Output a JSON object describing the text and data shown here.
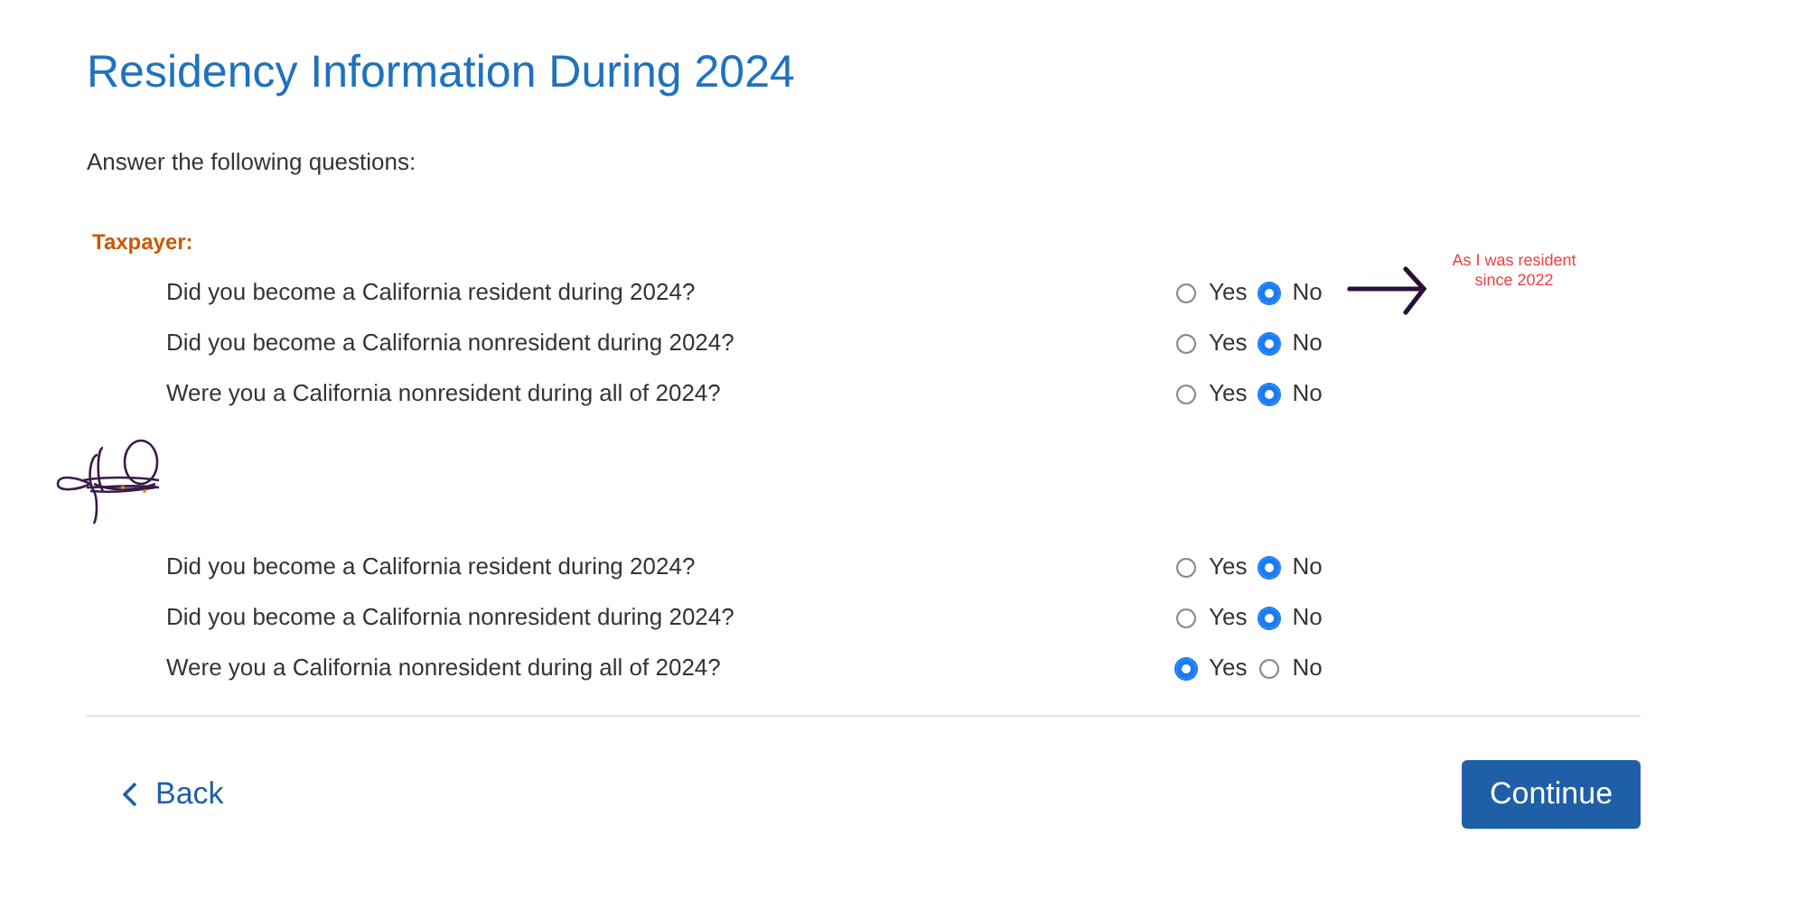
{
  "title": "Residency Information During 2024",
  "intro": "Answer the following questions:",
  "groups": [
    {
      "kind": "labeled",
      "label": "Taxpayer:",
      "questions": [
        {
          "text": "Did you become a California resident during 2024?",
          "options": [
            {
              "label": "Yes",
              "selected": false
            },
            {
              "label": "No",
              "selected": true
            }
          ],
          "note": {
            "text": "As I was resident since 2022"
          }
        },
        {
          "text": "Did you become a California nonresident during 2024?",
          "options": [
            {
              "label": "Yes",
              "selected": false
            },
            {
              "label": "No",
              "selected": true
            }
          ]
        },
        {
          "text": "Were you a California nonresident during all of 2024?",
          "options": [
            {
              "label": "Yes",
              "selected": false
            },
            {
              "label": "No",
              "selected": true
            }
          ]
        }
      ]
    },
    {
      "kind": "scribbled",
      "questions": [
        {
          "text": "Did you become a California resident during 2024?",
          "options": [
            {
              "label": "Yes",
              "selected": false
            },
            {
              "label": "No",
              "selected": true
            }
          ]
        },
        {
          "text": "Did you become a California nonresident during 2024?",
          "options": [
            {
              "label": "Yes",
              "selected": false
            },
            {
              "label": "No",
              "selected": true
            }
          ]
        },
        {
          "text": "Were you a California nonresident during all of 2024?",
          "options": [
            {
              "label": "Yes",
              "selected": true
            },
            {
              "label": "No",
              "selected": false
            }
          ]
        }
      ]
    }
  ],
  "back": "Back",
  "continue": "Continue"
}
